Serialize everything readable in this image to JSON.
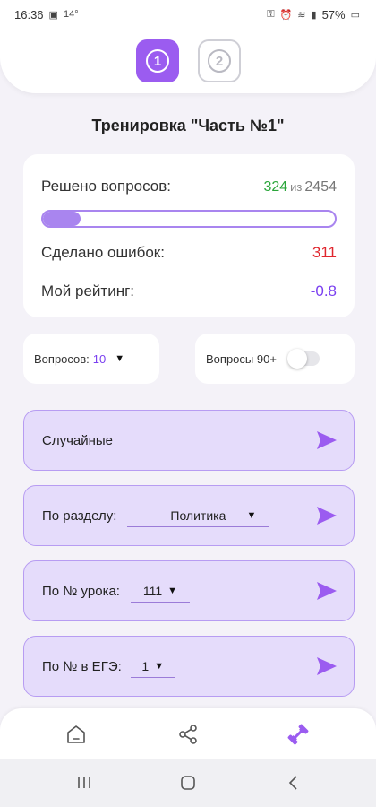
{
  "status_bar": {
    "time": "16:36",
    "temperature": "14°",
    "battery": "57%"
  },
  "steps": [
    {
      "label": "1",
      "active": true
    },
    {
      "label": "2",
      "active": false
    }
  ],
  "page_title": "Тренировка \"Часть №1\"",
  "stats": {
    "solved_label": "Решено вопросов:",
    "solved_count": "324",
    "solved_of": "из",
    "solved_total": "2454",
    "progress_fraction": 0.13,
    "errors_label": "Сделано ошибок:",
    "errors_value": "311",
    "rating_label": "Мой рейтинг:",
    "rating_value": "-0.8"
  },
  "controls": {
    "questions_label": "Вопросов:",
    "questions_value": "10",
    "q90_label": "Вопросы 90+",
    "q90_enabled": false
  },
  "actions": {
    "random_label": "Случайные",
    "section_label": "По разделу:",
    "section_value": "Политика",
    "lesson_label": "По № урока:",
    "lesson_value": "111",
    "ege_label": "По № в ЕГЭ:",
    "ege_value": "1"
  },
  "colors": {
    "accent": "#9b5cf0",
    "card_tint": "#e5dcfb",
    "solved_green": "#2aa53a",
    "error_red": "#e0262e",
    "rating_purple": "#7a3ff0"
  },
  "icons": [
    "home-icon",
    "share-icon",
    "dumbbell-icon",
    "send-icon"
  ]
}
